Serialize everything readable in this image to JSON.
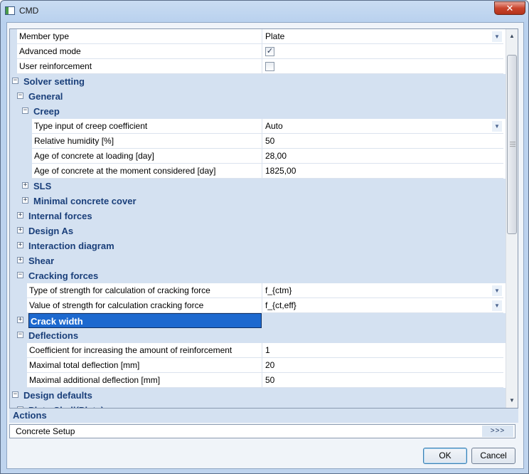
{
  "window": {
    "title": "CMD",
    "close_label": "✕"
  },
  "grid": {
    "rows": [
      {
        "type": "prop",
        "label": "Member type",
        "value": "Plate",
        "dropdown": true,
        "indent": 0
      },
      {
        "type": "check",
        "label": "Advanced mode",
        "checked": true,
        "indent": 0
      },
      {
        "type": "check",
        "label": "User reinforcement",
        "checked": false,
        "indent": 0
      },
      {
        "type": "cat",
        "label": "Solver setting",
        "expanded": true,
        "level": 0
      },
      {
        "type": "cat",
        "label": "General",
        "expanded": true,
        "level": 1
      },
      {
        "type": "cat",
        "label": "Creep",
        "expanded": true,
        "level": 2
      },
      {
        "type": "prop",
        "label": "Type input of creep coefficient",
        "value": "Auto",
        "dropdown": true,
        "indent": 3
      },
      {
        "type": "prop",
        "label": "Relative humidity [%]",
        "value": "50",
        "indent": 3
      },
      {
        "type": "prop",
        "label": "Age of concrete at loading [day]",
        "value": "28,00",
        "indent": 3
      },
      {
        "type": "prop",
        "label": "Age of concrete at the moment considered [day]",
        "value": "1825,00",
        "indent": 3
      },
      {
        "type": "cat",
        "label": "SLS",
        "expanded": false,
        "level": 2
      },
      {
        "type": "cat",
        "label": "Minimal concrete cover",
        "expanded": false,
        "level": 2
      },
      {
        "type": "cat",
        "label": "Internal forces",
        "expanded": false,
        "level": 1
      },
      {
        "type": "cat",
        "label": "Design As",
        "expanded": false,
        "level": 1
      },
      {
        "type": "cat",
        "label": "Interaction diagram",
        "expanded": false,
        "level": 1
      },
      {
        "type": "cat",
        "label": "Shear",
        "expanded": false,
        "level": 1
      },
      {
        "type": "cat",
        "label": "Cracking forces",
        "expanded": true,
        "level": 1
      },
      {
        "type": "prop",
        "label": "Type of strength for calculation of cracking force",
        "value": "f_{ctm}",
        "dropdown": true,
        "indent": 2
      },
      {
        "type": "prop",
        "label": "Value of strength for calculation cracking force",
        "value": "f_{ct,eff}",
        "dropdown": true,
        "indent": 2
      },
      {
        "type": "cat",
        "label": "Crack width",
        "expanded": false,
        "level": 1,
        "selected": true
      },
      {
        "type": "cat",
        "label": "Deflections",
        "expanded": true,
        "level": 1
      },
      {
        "type": "prop",
        "label": "Coefficient for increasing the amount of reinforcement",
        "value": "1",
        "indent": 2
      },
      {
        "type": "prop",
        "label": "Maximal total deflection [mm]",
        "value": "20",
        "indent": 2
      },
      {
        "type": "prop",
        "label": "Maximal additional deflection [mm]",
        "value": "50",
        "indent": 2
      },
      {
        "type": "cat",
        "label": "Design defaults",
        "expanded": true,
        "level": 0
      },
      {
        "type": "cat",
        "label": "Plate-Shell(Plate)",
        "expanded": true,
        "level": 1
      }
    ]
  },
  "actions": {
    "header": "Actions",
    "items": [
      {
        "label": "Concrete Setup",
        "button": ">>>"
      }
    ]
  },
  "buttons": {
    "ok": "OK",
    "cancel": "Cancel"
  },
  "icons": {
    "expand": "+",
    "collapse": "−",
    "check": "✓",
    "dropdown": "▼"
  },
  "colors": {
    "category_bg": "#d4e1f1",
    "category_text": "#1a3f7a",
    "selection": "#1d69cf"
  }
}
